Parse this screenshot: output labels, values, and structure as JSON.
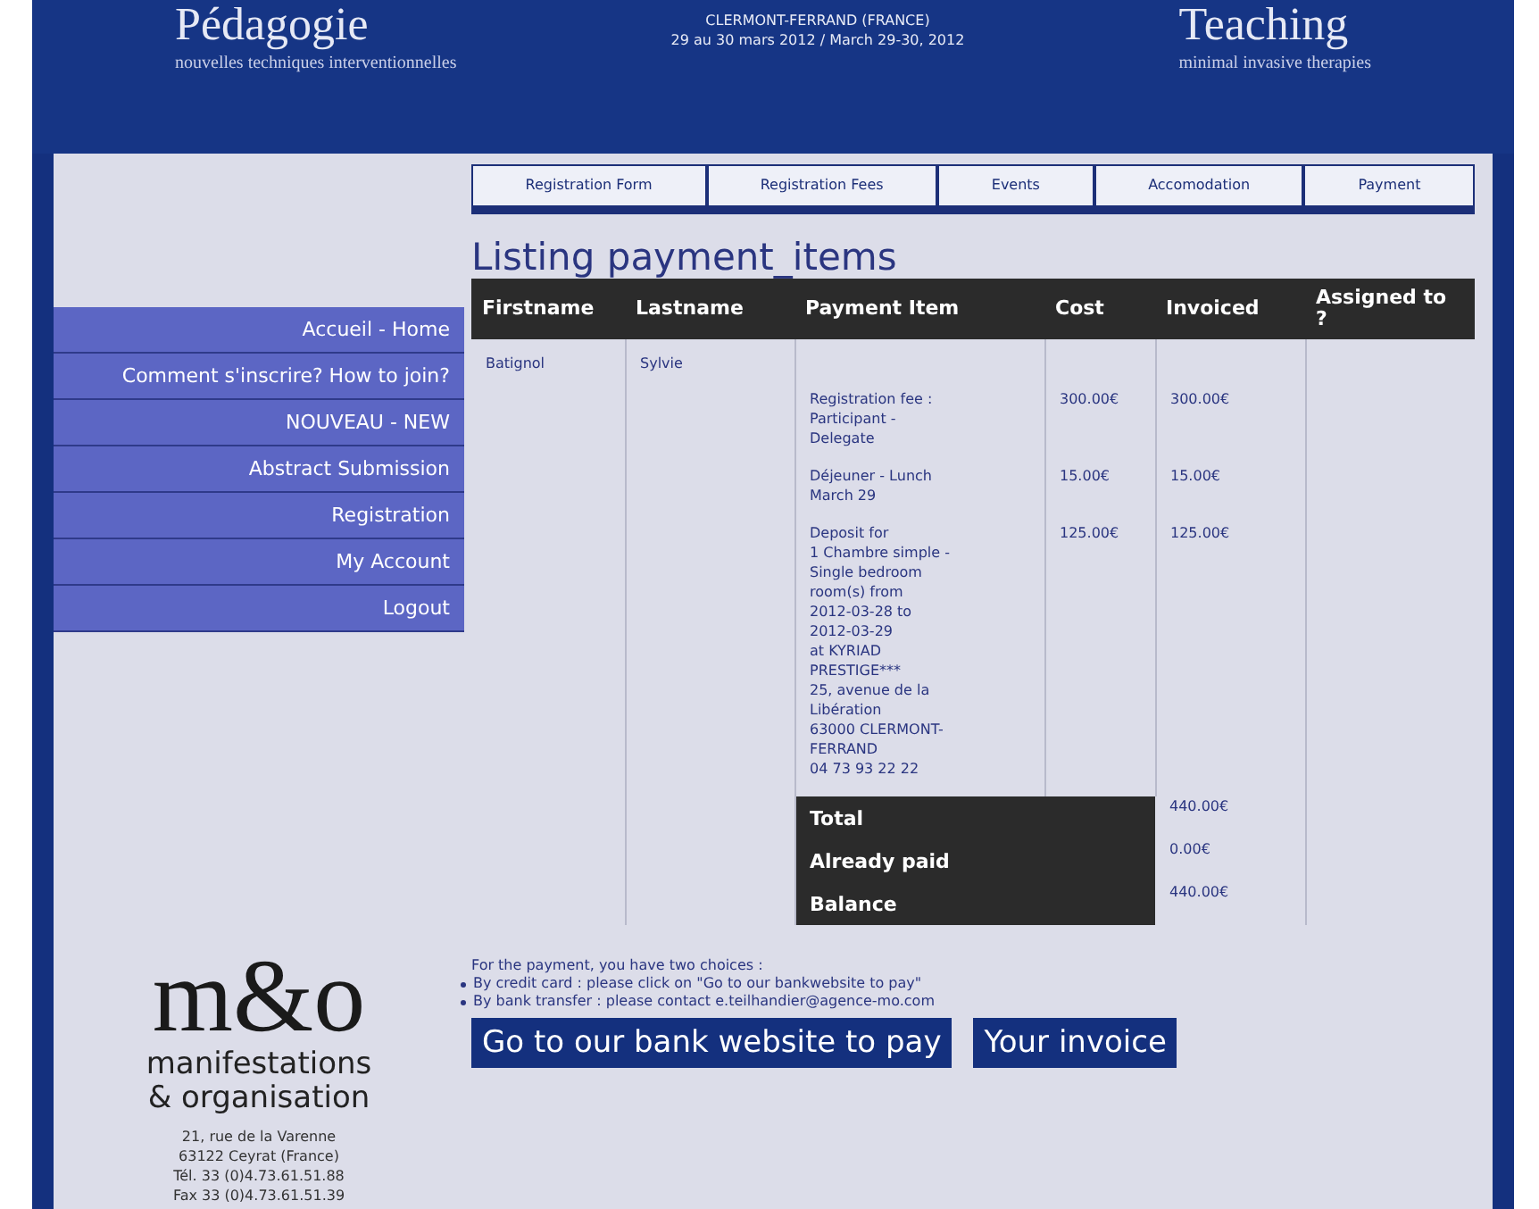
{
  "banner": {
    "left_title": "Pédagogie",
    "left_subtitle": "nouvelles techniques interventionnelles",
    "center_lines": [
      "CLERMONT-FERRAND (FRANCE)",
      "29 au 30 mars 2012 / March 29-30, 2012"
    ],
    "right_title": "Teaching",
    "right_subtitle": "minimal invasive therapies"
  },
  "sidebar": {
    "items": [
      {
        "label": "Accueil - Home",
        "selected": false
      },
      {
        "label": "Comment s'inscrire? How to join?",
        "selected": false
      },
      {
        "label": "NOUVEAU - NEW",
        "selected": false
      },
      {
        "label": "Abstract Submission",
        "selected": false
      },
      {
        "label": "Registration",
        "selected": false
      },
      {
        "label": "My Account",
        "selected": false
      },
      {
        "label": "Logout",
        "selected": false
      }
    ],
    "logo": {
      "mark": "m&o",
      "name_lines": [
        "manifestations",
        "& organisation"
      ],
      "address": [
        "21, rue de la Varenne",
        "63122 Ceyrat (France)",
        "Tél. 33 (0)4.73.61.51.88",
        "Fax 33 (0)4.73.61.51.39"
      ]
    }
  },
  "tabs": [
    {
      "label": "Registration Form",
      "selected": false
    },
    {
      "label": "Registration Fees",
      "selected": false
    },
    {
      "label": "Events",
      "selected": false
    },
    {
      "label": "Accomodation",
      "selected": false
    },
    {
      "label": "Payment",
      "selected": false
    }
  ],
  "title": "Listing payment_items",
  "table": {
    "columns": [
      "Firstname",
      "Lastname",
      "Payment Item",
      "Cost",
      "Invoiced",
      "Assigned to ?"
    ],
    "person": {
      "firstname": "Batignol",
      "lastname": "Sylvie"
    },
    "items": [
      {
        "item": "Registration fee :\nParticipant -\nDelegate",
        "cost": "300.00€",
        "invoiced": "300.00€"
      },
      {
        "item": "Déjeuner - Lunch\nMarch 29",
        "cost": "15.00€",
        "invoiced": "15.00€"
      },
      {
        "item": "Deposit for\n1 Chambre simple -\nSingle bedroom\nroom(s) from\n2012-03-28 to\n2012-03-29\nat KYRIAD\nPRESTIGE***\n25, avenue de la\nLibération\n63000 CLERMONT-\nFERRAND\n04 73 93 22 22",
        "cost": "125.00€",
        "invoiced": "125.00€"
      }
    ],
    "totals": [
      {
        "label": "Total",
        "value": "440.00€"
      },
      {
        "label": "Already paid",
        "value": "0.00€"
      },
      {
        "label": "Balance",
        "value": "440.00€"
      }
    ]
  },
  "payment_note": {
    "intro": "For the payment, you have two choices :",
    "options": [
      "By credit card : please click on \"Go to our bankwebsite to pay\"",
      "By bank transfer : please contact e.teilhandier@agence-mo.com"
    ]
  },
  "buttons": [
    "Go to our bank website to pay",
    "Your invoice"
  ]
}
